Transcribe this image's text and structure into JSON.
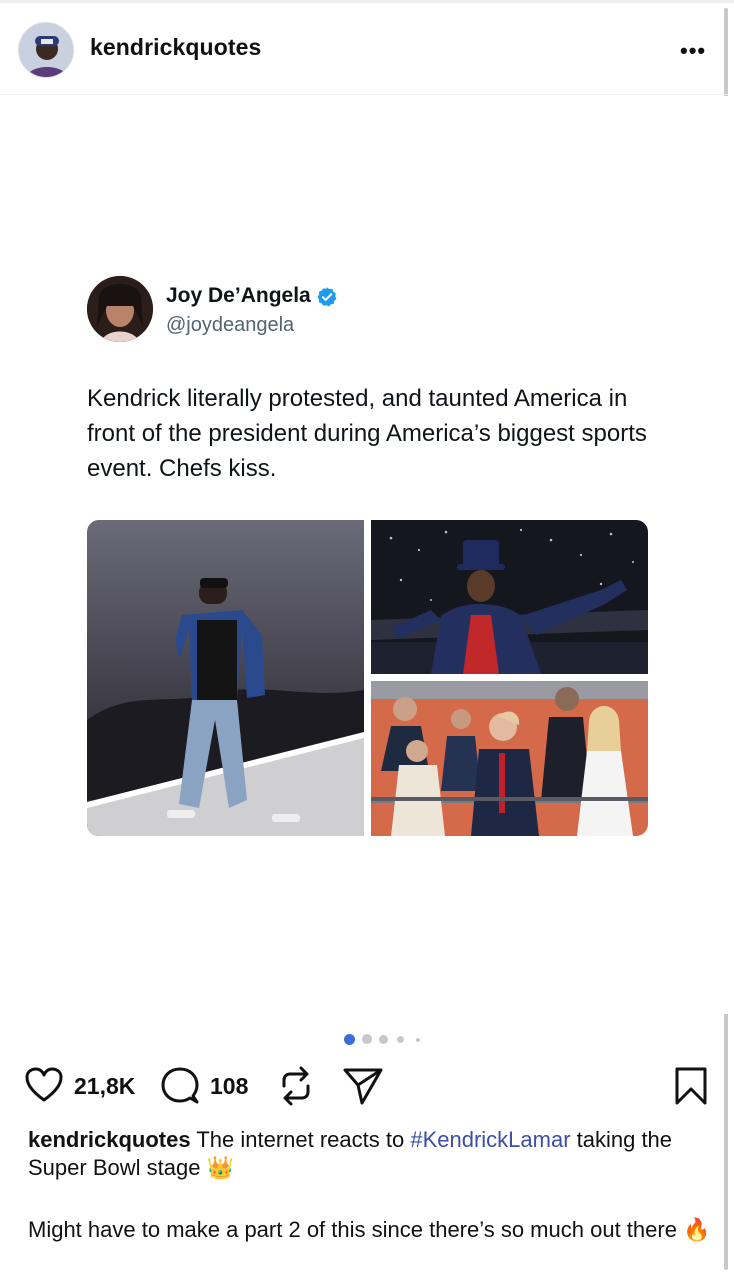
{
  "post": {
    "username": "kendrickquotes",
    "more_label": "•••"
  },
  "tweet": {
    "name": "Joy De’Angela",
    "handle": "@joydeangela",
    "text": "Kendrick literally protested, and taunted America in front of the president during America’s biggest sports event. Chefs kiss.",
    "verified_color": "#1d9bf0"
  },
  "carousel": {
    "total": 5,
    "active_index": 0,
    "active_color": "#3b6fd8"
  },
  "actions": {
    "likes": "21,8K",
    "comments": "108"
  },
  "caption": {
    "username": "kendrickquotes",
    "text_before": " The internet reacts to ",
    "hashtag": "#KendrickLamar",
    "text_after": " taking the Super Bowl stage 👑",
    "line2": "Might have to make a part 2 of this since there’s so much out there 🔥"
  },
  "colors": {
    "hashtag": "#3b4ea8",
    "text": "#111111",
    "handle": "#536471"
  }
}
